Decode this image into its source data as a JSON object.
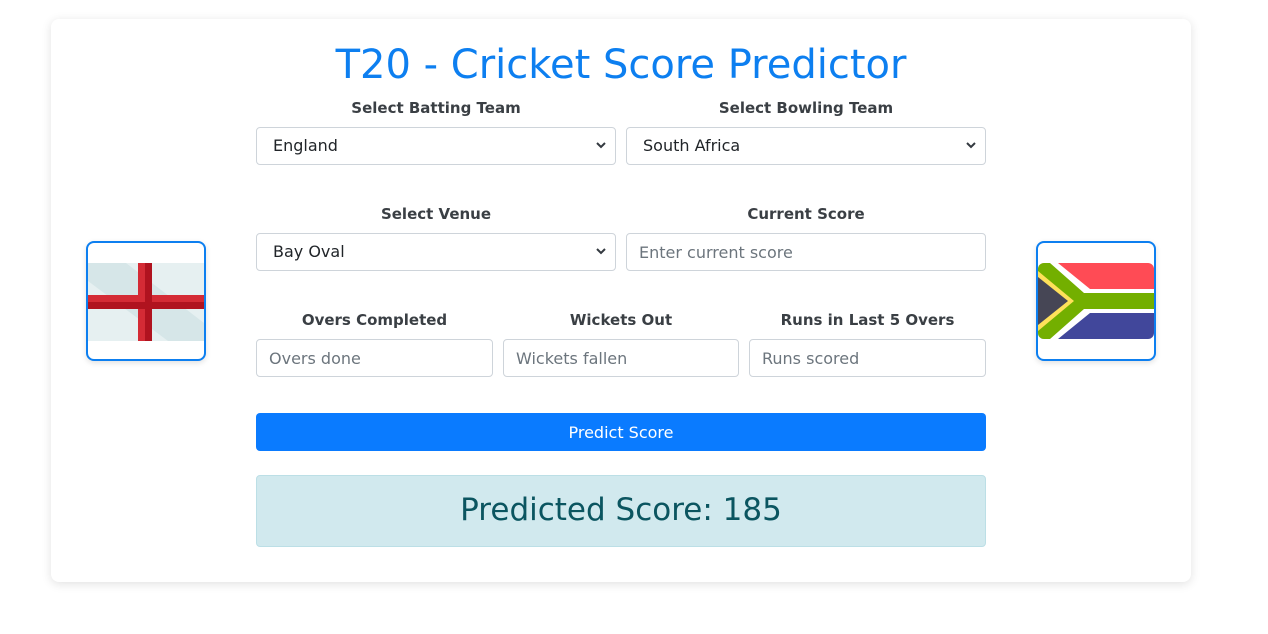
{
  "header": {
    "title": "T20 - Cricket Score Predictor"
  },
  "batting": {
    "label": "Select Batting Team",
    "selected": "England",
    "flag_icon": "england-flag-icon"
  },
  "bowling": {
    "label": "Select Bowling Team",
    "selected": "South Africa",
    "flag_icon": "south-africa-flag-icon"
  },
  "venue": {
    "label": "Select Venue",
    "selected": "Bay Oval"
  },
  "current_score": {
    "label": "Current Score",
    "placeholder": "Enter current score"
  },
  "overs": {
    "label": "Overs Completed",
    "placeholder": "Overs done"
  },
  "wickets": {
    "label": "Wickets Out",
    "placeholder": "Wickets fallen"
  },
  "last5": {
    "label": "Runs in Last 5 Overs",
    "placeholder": "Runs scored"
  },
  "predict_button": {
    "label": "Predict Score"
  },
  "result": {
    "text": "Predicted Score: 185"
  },
  "colors": {
    "accent": "#0d7ff0",
    "button": "#0a7bff",
    "result_bg": "#d1e9ee",
    "result_text": "#0b5560"
  }
}
